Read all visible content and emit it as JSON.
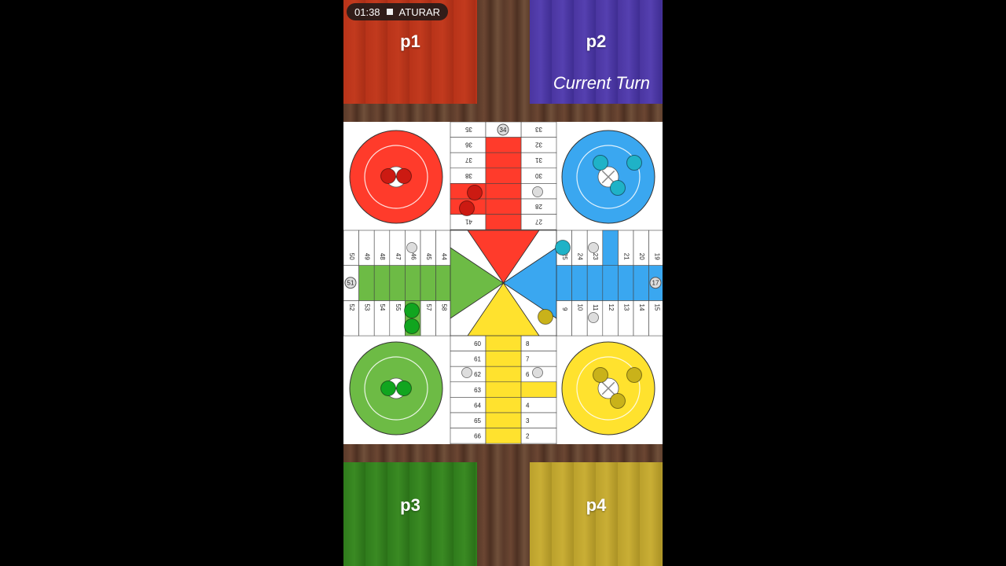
{
  "status_bar": {
    "time": "01:38",
    "stop_label": "ATURAR"
  },
  "players": [
    {
      "id": "p1",
      "name": "p1",
      "color": "#c23a1e"
    },
    {
      "id": "p2",
      "name": "p2",
      "color": "#5540b0"
    },
    {
      "id": "p3",
      "name": "p3",
      "color": "#3a8a23"
    },
    {
      "id": "p4",
      "name": "p4",
      "color": "#c9ae35"
    }
  ],
  "current_turn": {
    "player": "p2",
    "label": "Current Turn"
  },
  "board": {
    "colors": {
      "red": "#ff3b2b",
      "blue": "#3aa7f0",
      "green": "#6dbb45",
      "yellow": "#ffe22e"
    },
    "top_left_column": [
      "35",
      "36",
      "37",
      "38",
      "39",
      "40",
      "41",
      "42"
    ],
    "top_right_column": [
      "33",
      "32",
      "31",
      "30",
      "29",
      "28",
      "27",
      "26"
    ],
    "top_safe": "34",
    "right_top_row": [
      "25",
      "24",
      "23",
      "22",
      "21",
      "20",
      "19",
      "18"
    ],
    "right_bottom_row": [
      "9",
      "10",
      "11",
      "12",
      "13",
      "14",
      "15",
      "16"
    ],
    "right_safe": "17",
    "bottom_left_column": [
      "60",
      "61",
      "62",
      "63",
      "64",
      "65",
      "66",
      "67"
    ],
    "bottom_right_column": [
      "8",
      "7",
      "6",
      "5",
      "4",
      "3",
      "2",
      "1"
    ],
    "bottom_safe": "68",
    "left_top_row": [
      "50",
      "49",
      "48",
      "47",
      "46",
      "45",
      "44",
      "43"
    ],
    "left_bottom_row": [
      "52",
      "53",
      "54",
      "55",
      "56",
      "57",
      "58",
      "59"
    ],
    "left_safe": "51",
    "tokens": {
      "red": [
        "home",
        "home",
        "lane-1",
        "lane-2"
      ],
      "blue": [
        "home",
        "home",
        "home",
        "track-24"
      ],
      "green": [
        "home",
        "home",
        "lane-1",
        "lane-2"
      ],
      "yellow": [
        "home",
        "home",
        "home",
        "track-9"
      ]
    }
  }
}
